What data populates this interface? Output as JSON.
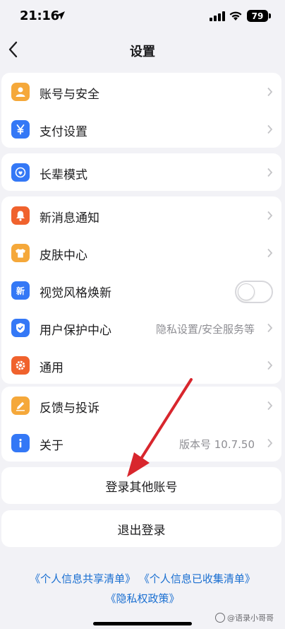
{
  "status_bar": {
    "time": "21:16",
    "battery": "79"
  },
  "nav": {
    "title": "设置"
  },
  "groups": [
    {
      "rows": [
        {
          "label": "账号与安全",
          "icon": "account-icon",
          "color": "#f5a83a"
        },
        {
          "label": "支付设置",
          "icon": "yen-icon",
          "color": "#3478f6"
        }
      ]
    },
    {
      "rows": [
        {
          "label": "长辈模式",
          "icon": "elder-mode-icon",
          "color": "#3478f6"
        }
      ]
    },
    {
      "rows": [
        {
          "label": "新消息通知",
          "icon": "bell-icon",
          "color": "#f0622d"
        },
        {
          "label": "皮肤中心",
          "icon": "shirt-icon",
          "color": "#f5a83a"
        },
        {
          "label": "视觉风格焕新",
          "icon": "new-style-icon",
          "color": "#3478f6",
          "icon_text": "新",
          "toggle": false
        },
        {
          "label": "用户保护中心",
          "icon": "shield-icon",
          "color": "#3478f6",
          "value": "隐私设置/安全服务等"
        },
        {
          "label": "通用",
          "icon": "gear-icon",
          "color": "#f0622d"
        }
      ]
    },
    {
      "rows": [
        {
          "label": "反馈与投诉",
          "icon": "pencil-icon",
          "color": "#f5a83a"
        },
        {
          "label": "关于",
          "icon": "info-icon",
          "color": "#3478f6",
          "value": "版本号 10.7.50"
        }
      ]
    }
  ],
  "actions": {
    "switch_account": "登录其他账号",
    "logout": "退出登录"
  },
  "links": {
    "shared_list": "《个人信息共享清单》",
    "collected_list": "《个人信息已收集清单》",
    "privacy_policy": "《隐私权政策》"
  },
  "watermark": "@语录小哥哥",
  "colors": {
    "link": "#1a6fd1",
    "background": "#f2f2f6",
    "annotation_arrow": "#d8262d"
  }
}
